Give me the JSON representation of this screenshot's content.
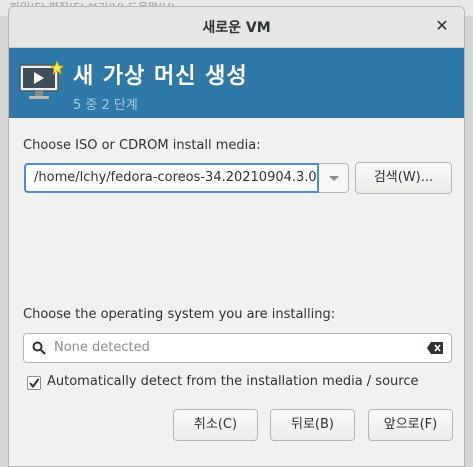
{
  "backdrop": {
    "menu": "  파일(F)   편집(E)   보기(V)   도움말(H)"
  },
  "window": {
    "title": "새로운 VM"
  },
  "banner": {
    "heading": "새 가상 머신 생성",
    "step": "5 중 2 단계"
  },
  "iso": {
    "label": "Choose ISO or CDROM install media:",
    "value": "/home/lchy/fedora-coreos-34.20210904.3.0",
    "browse_label": "검색(W)..."
  },
  "os": {
    "label": "Choose the operating system you are installing:",
    "placeholder": "None detected",
    "auto_detect_label": "Automatically detect from the installation media / source",
    "auto_detect_checked": true
  },
  "footer": {
    "cancel_label": "취소(C)",
    "back_label": "뒤로(B)",
    "forward_label": "앞으로(F)"
  },
  "colors": {
    "banner": "#2f79a8",
    "focus": "#4a90d9"
  },
  "icons": {
    "banner": "monitor-star-icon",
    "close": "close-icon",
    "search": "search-icon",
    "clear": "clear-text-icon",
    "dropdown": "chevron-down-icon",
    "check": "checkmark-icon"
  }
}
